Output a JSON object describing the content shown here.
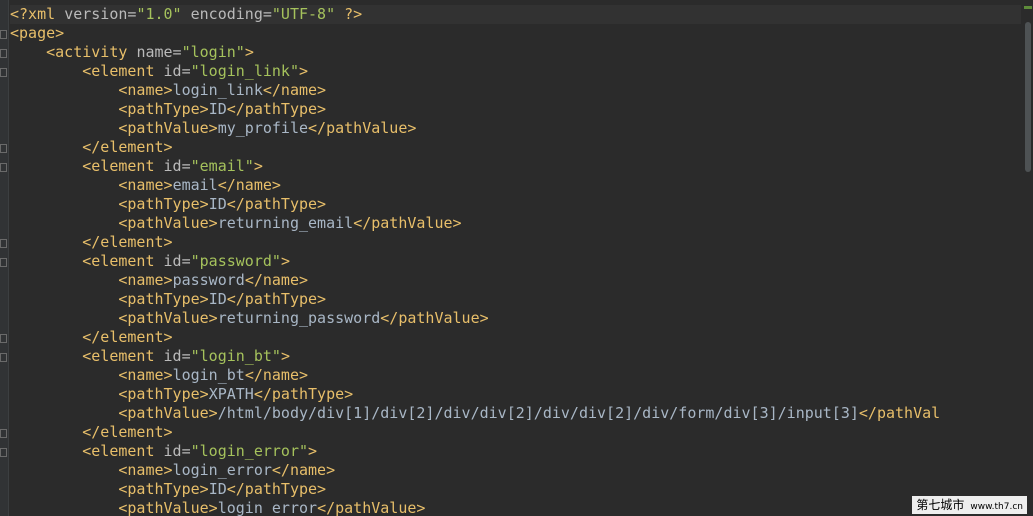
{
  "editor": {
    "lines": [
      [
        [
          "tag",
          "<?xml "
        ],
        [
          "attr",
          "version="
        ],
        [
          "val",
          "\"1.0\""
        ],
        [
          "attr",
          " encoding="
        ],
        [
          "val",
          "\"UTF-8\""
        ],
        [
          "tag",
          " ?>"
        ]
      ],
      [
        [
          "tag",
          "<page>"
        ]
      ],
      [
        [
          "tag",
          "    <activity "
        ],
        [
          "attr",
          "name="
        ],
        [
          "val",
          "\"login\""
        ],
        [
          "tag",
          ">"
        ]
      ],
      [
        [
          "tag",
          "        <element "
        ],
        [
          "attr",
          "id="
        ],
        [
          "val",
          "\"login_link\""
        ],
        [
          "tag",
          ">"
        ]
      ],
      [
        [
          "tag",
          "            <name>"
        ],
        [
          "text",
          "login_link"
        ],
        [
          "tag",
          "</name>"
        ]
      ],
      [
        [
          "tag",
          "            <pathType>"
        ],
        [
          "text",
          "ID"
        ],
        [
          "tag",
          "</pathType>"
        ]
      ],
      [
        [
          "tag",
          "            <pathValue>"
        ],
        [
          "text",
          "my_profile"
        ],
        [
          "tag",
          "</pathValue>"
        ]
      ],
      [
        [
          "tag",
          "        </element>"
        ]
      ],
      [
        [
          "tag",
          "        <element "
        ],
        [
          "attr",
          "id="
        ],
        [
          "val",
          "\"email\""
        ],
        [
          "tag",
          ">"
        ]
      ],
      [
        [
          "tag",
          "            <name>"
        ],
        [
          "text",
          "email"
        ],
        [
          "tag",
          "</name>"
        ]
      ],
      [
        [
          "tag",
          "            <pathType>"
        ],
        [
          "text",
          "ID"
        ],
        [
          "tag",
          "</pathType>"
        ]
      ],
      [
        [
          "tag",
          "            <pathValue>"
        ],
        [
          "text",
          "returning_email"
        ],
        [
          "tag",
          "</pathValue>"
        ]
      ],
      [
        [
          "tag",
          "        </element>"
        ]
      ],
      [
        [
          "tag",
          "        <element "
        ],
        [
          "attr",
          "id="
        ],
        [
          "val",
          "\"password\""
        ],
        [
          "tag",
          ">"
        ]
      ],
      [
        [
          "tag",
          "            <name>"
        ],
        [
          "text",
          "password"
        ],
        [
          "tag",
          "</name>"
        ]
      ],
      [
        [
          "tag",
          "            <pathType>"
        ],
        [
          "text",
          "ID"
        ],
        [
          "tag",
          "</pathType>"
        ]
      ],
      [
        [
          "tag",
          "            <pathValue>"
        ],
        [
          "text",
          "returning_password"
        ],
        [
          "tag",
          "</pathValue>"
        ]
      ],
      [
        [
          "tag",
          "        </element>"
        ]
      ],
      [
        [
          "tag",
          "        <element "
        ],
        [
          "attr",
          "id="
        ],
        [
          "val",
          "\"login_bt\""
        ],
        [
          "tag",
          ">"
        ]
      ],
      [
        [
          "tag",
          "            <name>"
        ],
        [
          "text",
          "login_bt"
        ],
        [
          "tag",
          "</name>"
        ]
      ],
      [
        [
          "tag",
          "            <pathType>"
        ],
        [
          "text",
          "XPATH"
        ],
        [
          "tag",
          "</pathType>"
        ]
      ],
      [
        [
          "tag",
          "            <pathValue>"
        ],
        [
          "text",
          "/html/body/div[1]/div[2]/div/div[2]/div/div[2]/div/form/div[3]/input[3]"
        ],
        [
          "tag",
          "</pathVal"
        ]
      ],
      [
        [
          "tag",
          "        </element>"
        ]
      ],
      [
        [
          "tag",
          "        <element "
        ],
        [
          "attr",
          "id="
        ],
        [
          "val",
          "\"login_error\""
        ],
        [
          "tag",
          ">"
        ]
      ],
      [
        [
          "tag",
          "            <name>"
        ],
        [
          "text",
          "login_error"
        ],
        [
          "tag",
          "</name>"
        ]
      ],
      [
        [
          "tag",
          "            <pathType>"
        ],
        [
          "text",
          "ID"
        ],
        [
          "tag",
          "</pathType>"
        ]
      ],
      [
        [
          "tag",
          "            <pathValue>"
        ],
        [
          "text",
          "login_error"
        ],
        [
          "tag",
          "</pathValue>"
        ]
      ]
    ]
  },
  "watermark": {
    "main": "第七城市",
    "sub": "www.th7.cn"
  }
}
